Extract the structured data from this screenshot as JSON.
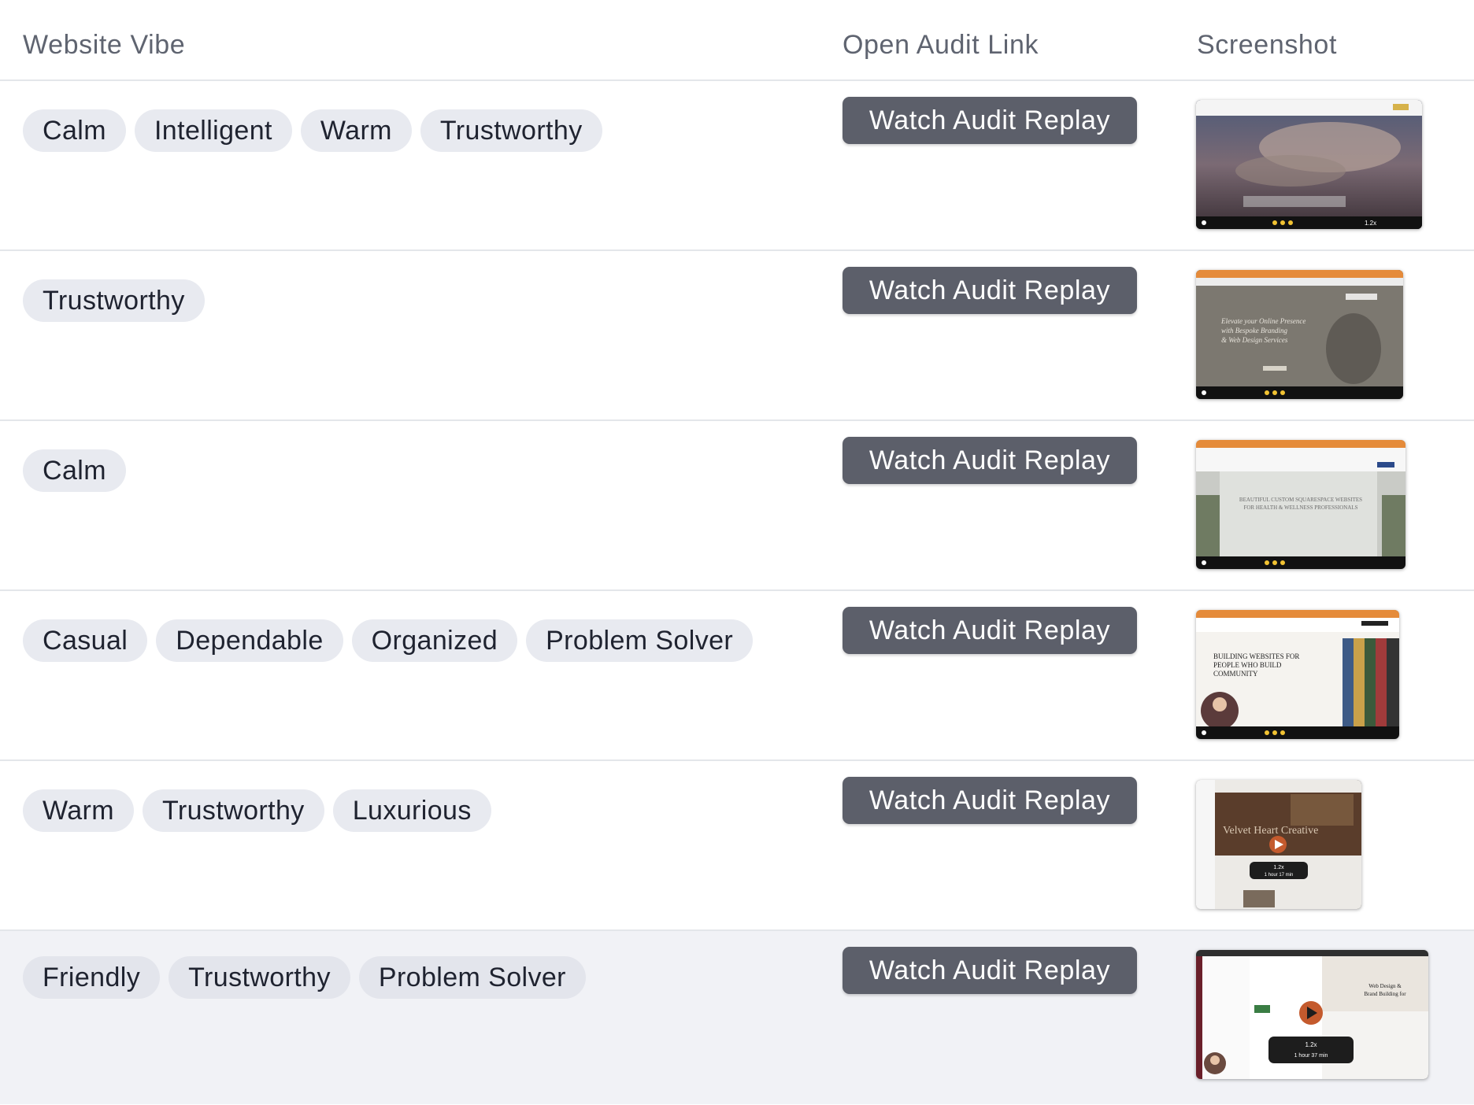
{
  "headers": {
    "website_vibe": "Website Vibe",
    "open_audit_link": "Open Audit Link",
    "screenshot": "Screenshot"
  },
  "button_label": "Watch Audit Replay",
  "rows": [
    {
      "tags": [
        "Calm",
        "Intelligent",
        "Warm",
        "Trustworthy"
      ],
      "thumbnail": {
        "caption": "",
        "speed": "1.2x"
      }
    },
    {
      "tags": [
        "Trustworthy"
      ],
      "thumbnail": {
        "headline_1": "Elevate your Online Presence",
        "headline_2": "with Bespoke Branding",
        "headline_3": "& Web Design Services"
      }
    },
    {
      "tags": [
        "Calm"
      ],
      "thumbnail": {
        "headline_1": "BEAUTIFUL CUSTOM SQUARESPACE WEBSITES",
        "headline_2": "FOR HEALTH & WELLNESS PROFESSIONALS"
      }
    },
    {
      "tags": [
        "Casual",
        "Dependable",
        "Organized",
        "Problem Solver"
      ],
      "thumbnail": {
        "headline_1": "BUILDING WEBSITES FOR",
        "headline_2": "PEOPLE WHO BUILD",
        "headline_3": "COMMUNITY"
      }
    },
    {
      "tags": [
        "Warm",
        "Trustworthy",
        "Luxurious"
      ],
      "thumbnail": {
        "headline_1": "Velvet Heart Creative",
        "speed": "1.2x",
        "duration": "1 hour 17 min"
      }
    },
    {
      "tags": [
        "Friendly",
        "Trustworthy",
        "Problem Solver"
      ],
      "thumbnail": {
        "headline_1": "Web Design &",
        "headline_2": "Brand Building for",
        "speed": "1.2x",
        "duration": "1 hour 37 min"
      }
    }
  ]
}
